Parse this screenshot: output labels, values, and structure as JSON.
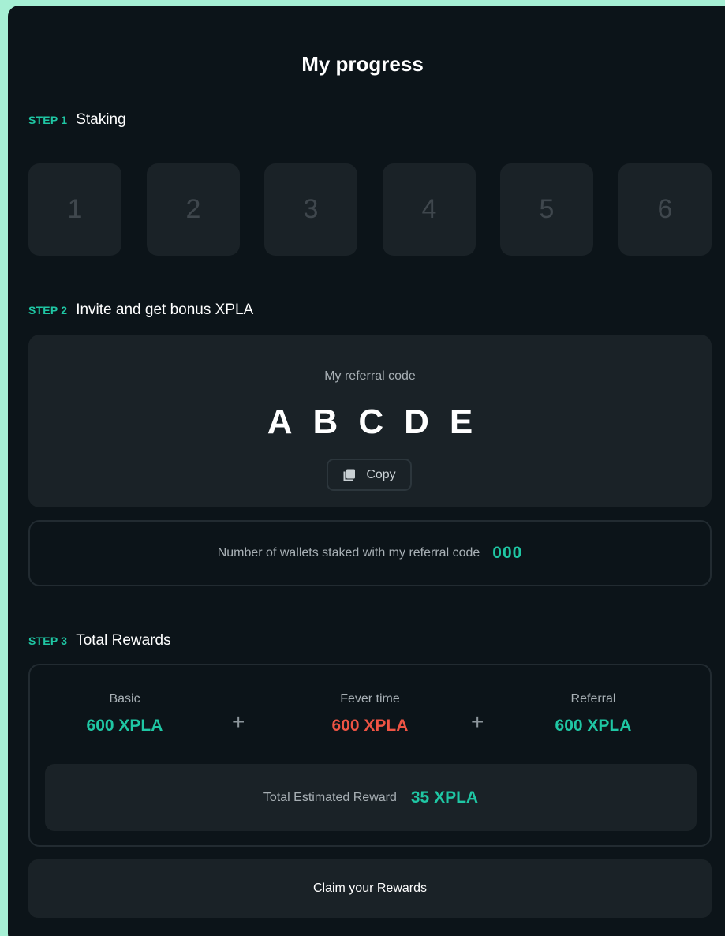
{
  "page": {
    "title": "My progress"
  },
  "colors": {
    "accent": "#1fc7a4",
    "fever": "#ef5444",
    "panel": "#0c1419",
    "card": "#1a2227"
  },
  "step1": {
    "tag": "STEP 1",
    "title": "Staking",
    "days": [
      "1",
      "2",
      "3",
      "4",
      "5",
      "6"
    ]
  },
  "step2": {
    "tag": "STEP 2",
    "title": "Invite and get bonus XPLA",
    "referral_label": "My referral code",
    "referral_code": "ABCDE",
    "copy_label": "Copy",
    "copy_icon": "copy-icon",
    "wallets_label": "Number of wallets staked with my referral code",
    "wallets_count": "000"
  },
  "step3": {
    "tag": "STEP 3",
    "title": "Total Rewards",
    "basic": {
      "label": "Basic",
      "value": "600 XPLA"
    },
    "fever": {
      "label": "Fever time",
      "value": "600 XPLA"
    },
    "referral": {
      "label": "Referral",
      "value": "600 XPLA"
    },
    "plus": "+",
    "total_label": "Total Estimated Reward",
    "total_value": "35 XPLA"
  },
  "claim_label": "Claim your Rewards"
}
